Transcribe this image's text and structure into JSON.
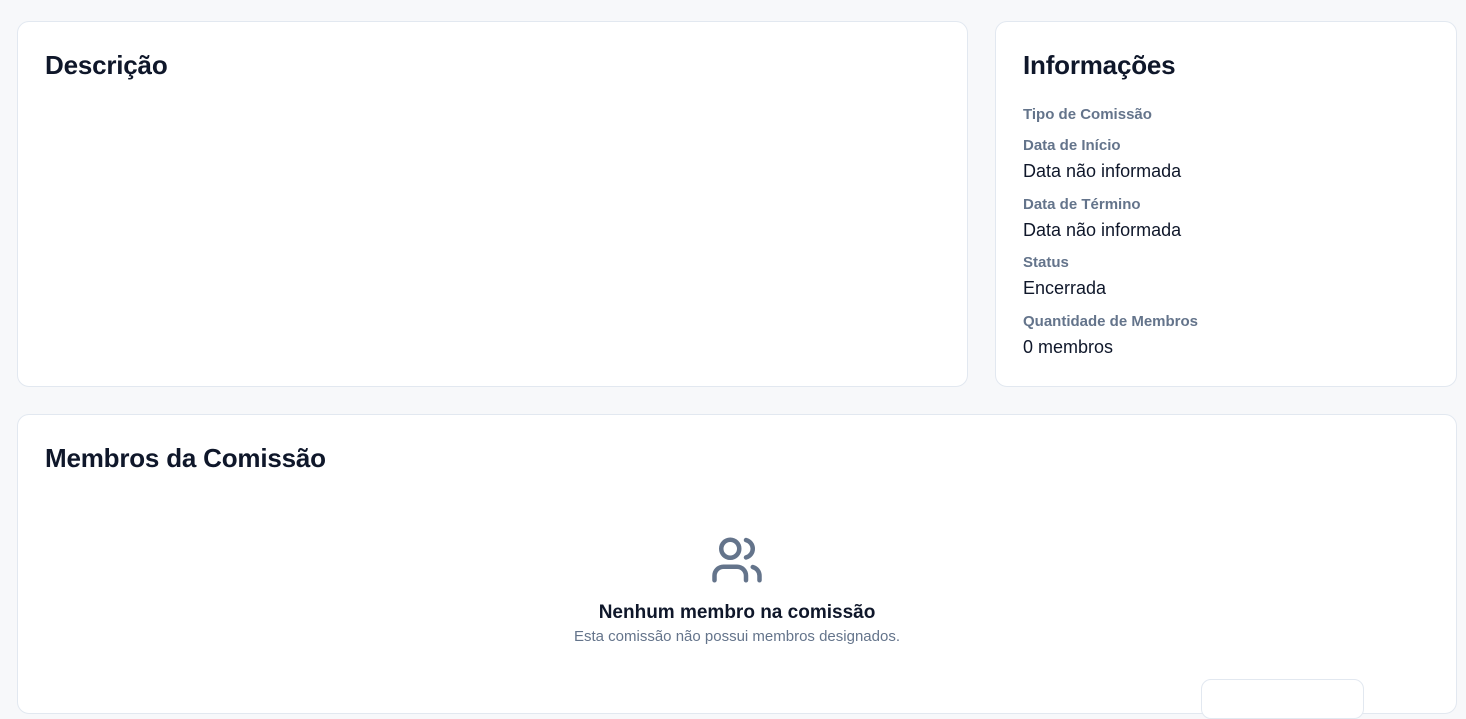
{
  "description_card": {
    "title": "Descrição"
  },
  "info_card": {
    "title": "Informações",
    "fields": [
      {
        "label": "Tipo de Comissão",
        "value": ""
      },
      {
        "label": "Data de Início",
        "value": "Data não informada"
      },
      {
        "label": "Data de Término",
        "value": "Data não informada"
      },
      {
        "label": "Status",
        "value": "Encerrada"
      },
      {
        "label": "Quantidade de Membros",
        "value": "0 membros"
      }
    ]
  },
  "members_card": {
    "title": "Membros da Comissão",
    "empty_state": {
      "icon": "users-icon",
      "title": "Nenhum membro na comissão",
      "subtitle": "Esta comissão não possui membros designados."
    }
  },
  "colors": {
    "background": "#f7f8fa",
    "card": "#ffffff",
    "border": "#e2e8f0",
    "text_primary": "#0f172a",
    "text_muted": "#64748b"
  }
}
